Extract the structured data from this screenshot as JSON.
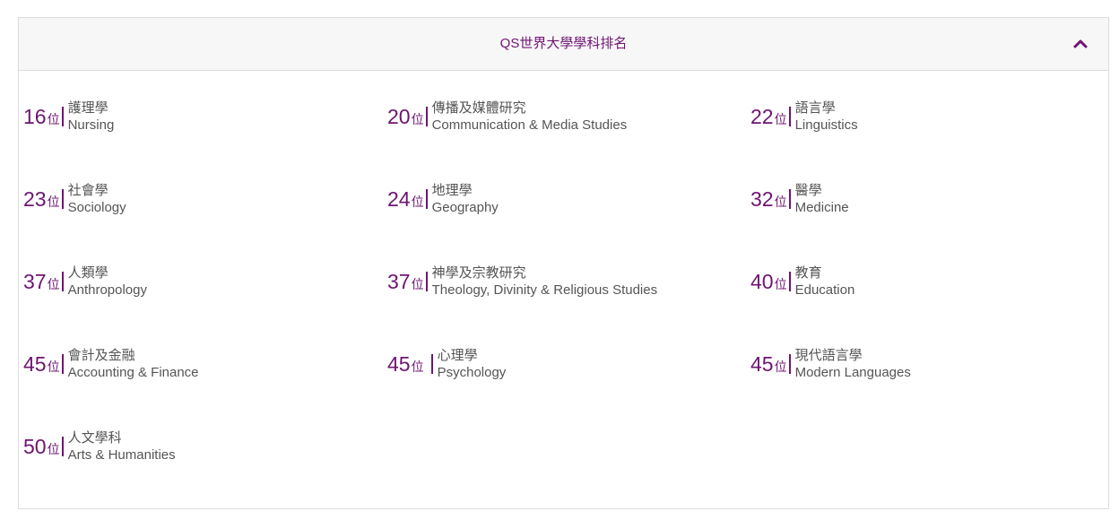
{
  "panel": {
    "title": "QS世界大學學科排名",
    "collapse_icon": "chevron-up-icon"
  },
  "rank_unit": "位",
  "rankings": [
    {
      "rank": "16",
      "zh": "護理學",
      "en": "Nursing"
    },
    {
      "rank": "20",
      "zh": "傳播及媒體研究",
      "en": "Communication & Media Studies"
    },
    {
      "rank": "22",
      "zh": "語言學",
      "en": "Linguistics"
    },
    {
      "rank": "23",
      "zh": "社會學",
      "en": "Sociology"
    },
    {
      "rank": "24",
      "zh": "地理學",
      "en": "Geography"
    },
    {
      "rank": "32",
      "zh": "醫學",
      "en": "Medicine"
    },
    {
      "rank": "37",
      "zh": "人類學",
      "en": "Anthropology"
    },
    {
      "rank": "37",
      "zh": "神學及宗教研究",
      "en": "Theology, Divinity & Religious Studies"
    },
    {
      "rank": "40",
      "zh": "教育",
      "en": "Education"
    },
    {
      "rank": "45",
      "zh": "會計及金融",
      "en": "Accounting & Finance"
    },
    {
      "rank": "45",
      "zh": "心理學",
      "en": "Psychology"
    },
    {
      "rank": "45",
      "zh": "現代語言學",
      "en": "Modern Languages"
    },
    {
      "rank": "50",
      "zh": "人文學科",
      "en": "Arts & Humanities"
    }
  ],
  "colors": {
    "accent": "#6e1472",
    "text": "#555555",
    "header_bg": "#f7f7f7",
    "border": "#dcdcdc"
  }
}
